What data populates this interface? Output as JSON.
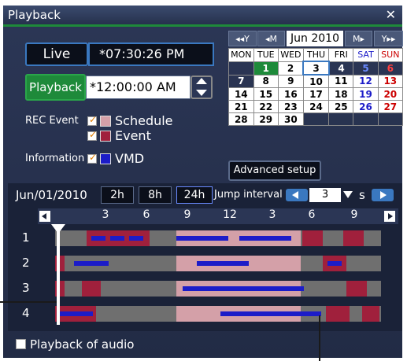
{
  "window": {
    "title": "Playback",
    "close_glyph": "✕"
  },
  "live": {
    "label": "Live",
    "time": "*07:30:26 PM"
  },
  "playback": {
    "label": "Playback",
    "time": "*12:00:00 AM"
  },
  "rec_event": {
    "label": "REC Event",
    "schedule_label": "Schedule",
    "event_label": "Event"
  },
  "information": {
    "label": "Information",
    "vmd_label": "VMD"
  },
  "calendar": {
    "nav": {
      "prev_year": "◂◂Y",
      "prev_month": "◂M",
      "next_month": "M▸",
      "next_year": "Y▸▸"
    },
    "month": "Jun 2010",
    "weekdays": [
      "MON",
      "TUE",
      "WED",
      "THU",
      "FRI",
      "SAT",
      "SUN"
    ],
    "weeks": [
      [
        "",
        "1",
        "2",
        "3",
        "4",
        "5",
        "6"
      ],
      [
        "7",
        "8",
        "9",
        "10",
        "11",
        "12",
        "13"
      ],
      [
        "14",
        "15",
        "16",
        "17",
        "18",
        "19",
        "20"
      ],
      [
        "21",
        "22",
        "23",
        "24",
        "25",
        "26",
        "27"
      ],
      [
        "28",
        "29",
        "30",
        "",
        "",
        "",
        ""
      ]
    ]
  },
  "advanced_setup": "Advanced setup",
  "timeline": {
    "date": "Jun/01/2010",
    "zoom_buttons": [
      "2h",
      "8h",
      "24h"
    ],
    "jump_interval_label": "Jump interval",
    "jump_value": "3",
    "jump_unit": "s",
    "hours": [
      "3",
      "6",
      "9",
      "12",
      "3",
      "6",
      "9"
    ],
    "rows": [
      "1",
      "2",
      "3",
      "4"
    ]
  },
  "playback_audio": {
    "label": "Playback of audio"
  },
  "colors": {
    "schedule": "#d4a0a8",
    "event": "#a0203c",
    "vmd": "#1c1cc8",
    "accent": "#1e8a3a"
  }
}
